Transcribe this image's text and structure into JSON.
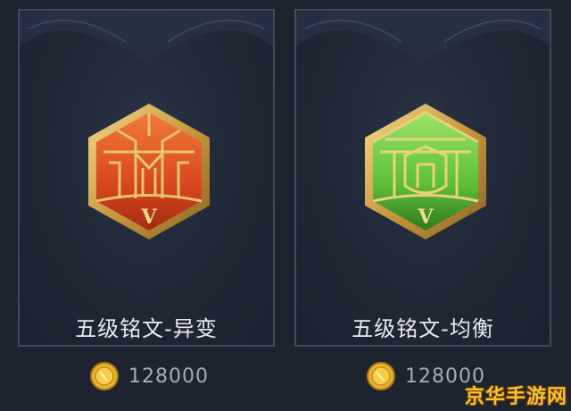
{
  "cards": [
    {
      "title": "五级铭文-异变",
      "emblem_color": "red",
      "emblem_mark": "V",
      "price": "128000",
      "currency_icon": "gold-coin-icon"
    },
    {
      "title": "五级铭文-均衡",
      "emblem_color": "green",
      "emblem_mark": "V",
      "price": "128000",
      "currency_icon": "gold-coin-icon"
    }
  ],
  "watermark": "京华手游网",
  "colors": {
    "background": "#1e2330",
    "card_border": "#3d4a60",
    "gold": "#d9b25a",
    "red_emblem": "#d9481e",
    "green_emblem": "#5fbf3a",
    "price_text": "#a5acb8",
    "title_text": "#e8eaef"
  }
}
